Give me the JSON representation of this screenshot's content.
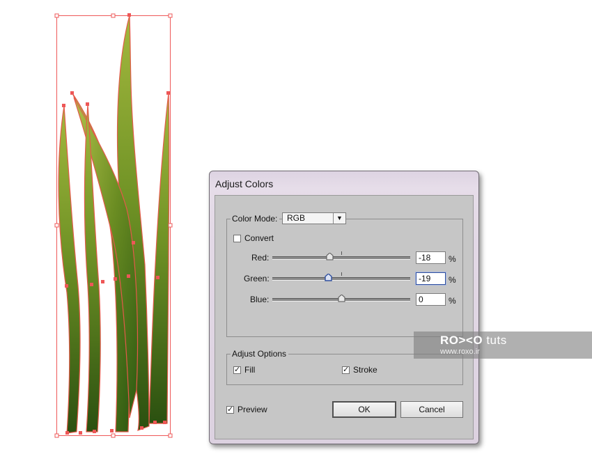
{
  "dialog": {
    "title": "Adjust Colors",
    "color_mode_label": "Color Mode:",
    "color_mode_value": "RGB",
    "convert_label": "Convert",
    "convert_checked": false,
    "sliders": [
      {
        "label": "Red:",
        "value": "-18",
        "unit": "%"
      },
      {
        "label": "Green:",
        "value": "-19",
        "unit": "%"
      },
      {
        "label": "Blue:",
        "value": "0",
        "unit": "%"
      }
    ],
    "adjust_options_label": "Adjust Options",
    "fill_label": "Fill",
    "fill_checked": true,
    "stroke_label": "Stroke",
    "stroke_checked": true,
    "preview_label": "Preview",
    "preview_checked": true,
    "ok_label": "OK",
    "cancel_label": "Cancel"
  },
  "watermark": {
    "brand_prefix": "RO><O",
    "brand_suffix": "tuts",
    "url": "www.roxo.ir"
  },
  "colors": {
    "selection": "#ee5757",
    "grass_light": "#9bb33a",
    "grass_dark": "#2f5a12",
    "dialog_body": "#c6c6c6",
    "active_field": "#2f4f9e"
  },
  "icons": {
    "dropdown": "chevron-down-icon",
    "check": "checkmark-icon",
    "slider_thumb": "slider-thumb-icon"
  }
}
